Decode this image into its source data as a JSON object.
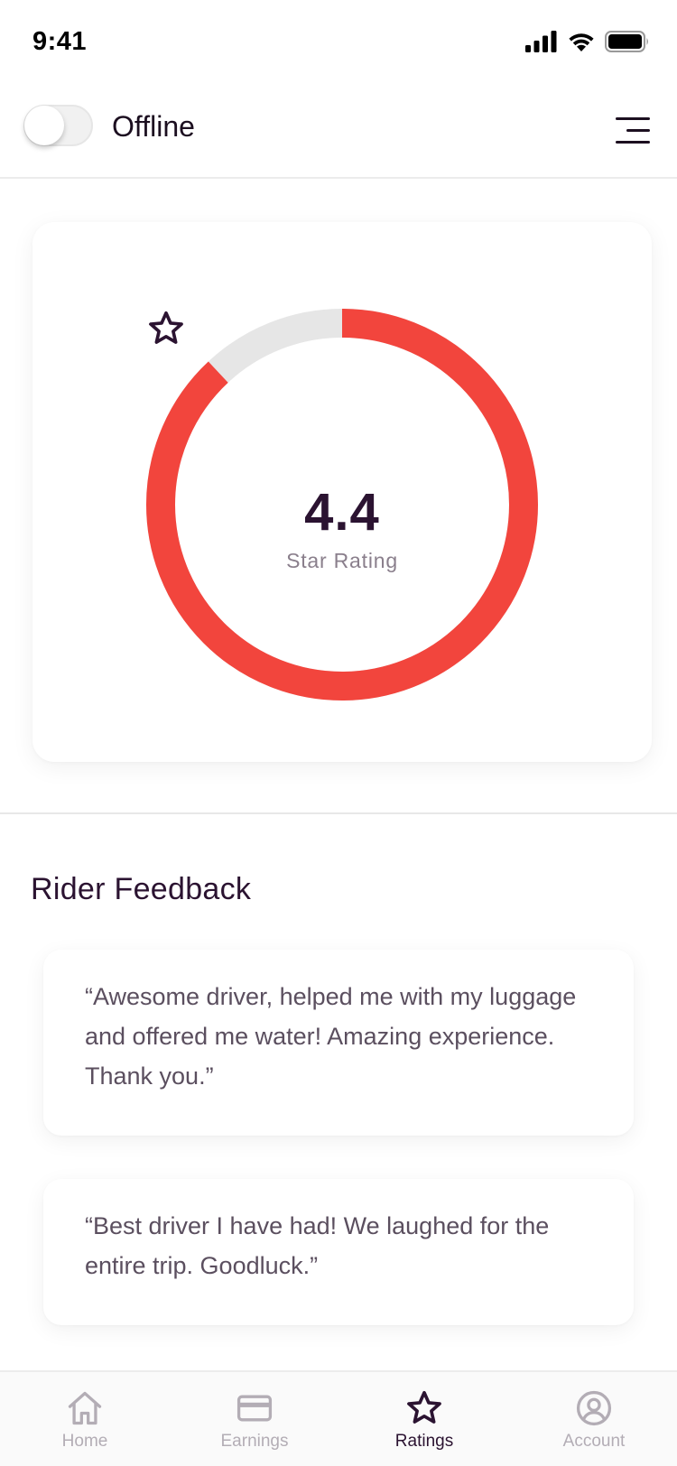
{
  "status_bar": {
    "time": "9:41"
  },
  "top_bar": {
    "status_label": "Offline",
    "online": false
  },
  "rating": {
    "value": "4.4",
    "caption": "Star Rating",
    "max": 5,
    "color_fill": "#f2453d",
    "color_track": "#e6e6e6"
  },
  "feedback": {
    "title": "Rider Feedback",
    "items": [
      {
        "text": "“Awesome driver, helped me with my luggage and offered me water! Amazing experience. Thank you.”"
      },
      {
        "text": "“Best driver I have had! We laughed for the entire trip. Goodluck.”"
      }
    ]
  },
  "nav": {
    "items": [
      {
        "label": "Home",
        "icon": "home-icon"
      },
      {
        "label": "Earnings",
        "icon": "card-icon"
      },
      {
        "label": "Ratings",
        "icon": "star-icon",
        "active": true
      },
      {
        "label": "Account",
        "icon": "account-icon"
      }
    ]
  }
}
